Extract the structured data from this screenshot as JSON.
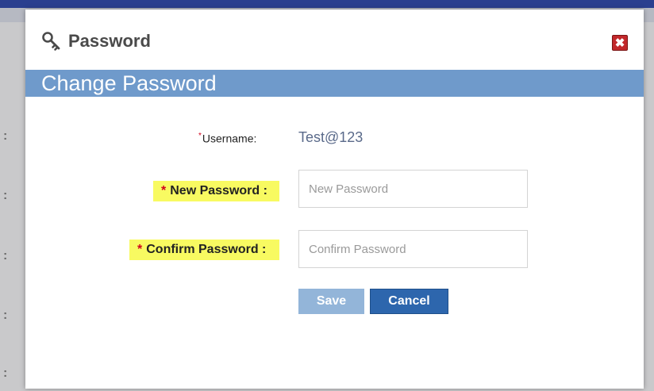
{
  "modal": {
    "title": "Password",
    "close_label": "✖",
    "section_title": "Change Password"
  },
  "form": {
    "username_label": "Username:",
    "username_value": "Test@123",
    "required_marker": "*",
    "new_password_label": "New Password :",
    "new_password_placeholder": "New Password",
    "new_password_value": "",
    "confirm_password_label": "Confirm Password :",
    "confirm_password_placeholder": "Confirm Password",
    "confirm_password_value": ""
  },
  "buttons": {
    "save_label": "Save",
    "cancel_label": "Cancel"
  },
  "background": {
    "colon": ":"
  },
  "colors": {
    "section_bar": "#6f9acb",
    "highlight": "#f8fa61",
    "cancel_button": "#2d66ad",
    "save_button": "#93b5d9",
    "close_button": "#c2282b"
  },
  "icons": {
    "title_icon": "key-icon",
    "close_icon": "close-icon"
  }
}
